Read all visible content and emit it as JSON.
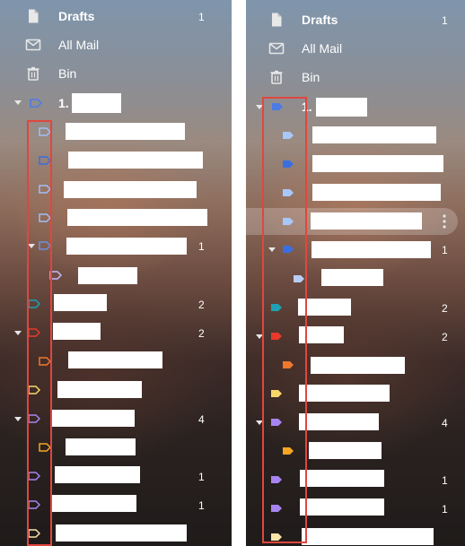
{
  "system_items": [
    {
      "name": "drafts",
      "label": "Drafts",
      "bold": true,
      "count": "1"
    },
    {
      "name": "all-mail",
      "label": "All Mail",
      "bold": false,
      "count": ""
    },
    {
      "name": "bin",
      "label": "Bin",
      "bold": false,
      "count": ""
    }
  ],
  "top_label_prefix": "1.",
  "left_panel": {
    "label_counts": [
      "",
      "",
      "",
      "",
      "",
      "1",
      "",
      "2",
      "2",
      "",
      "",
      "4",
      "",
      "1",
      "1",
      ""
    ]
  },
  "right_panel": {
    "label_counts": [
      "",
      "",
      "",
      "",
      "",
      "1",
      "",
      "2",
      "2",
      "",
      "",
      "4",
      "",
      "1",
      "1",
      ""
    ],
    "label_colors": [
      "#4c7be6",
      "#a8c7fa",
      "#3b6fe0",
      "#a8c7fa",
      "#a8c7fa",
      "#3b6fe0",
      "#b9cdf7",
      "#1ea0b5",
      "#e8392b",
      "#f0782c",
      "#f7d76a",
      "#a884f0",
      "#f5a623",
      "#a884f0",
      "#a884f0",
      "#f8e3a8"
    ]
  },
  "icons": {
    "zoom": "zoom-out-icon",
    "drafts": "draft-file-icon",
    "all_mail": "envelope-icon",
    "bin": "trash-icon",
    "label": "label-tag-icon",
    "caret": "caret-down-icon",
    "more": "more-vertical-icon"
  },
  "colors": {
    "highlight": "#e0463f",
    "text": "#ffffff"
  }
}
